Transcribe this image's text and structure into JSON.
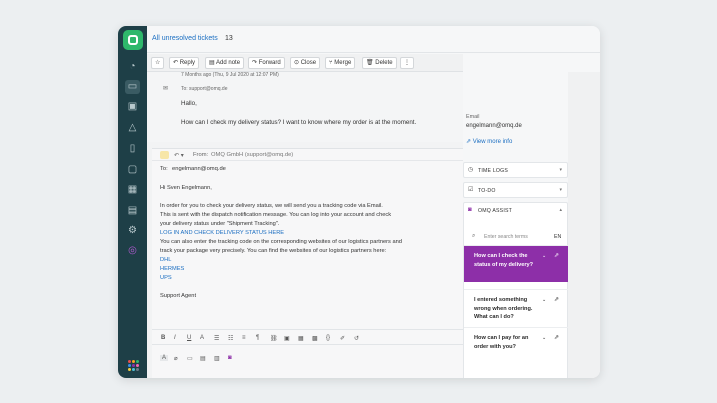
{
  "sidebar": {
    "icons": [
      "dashboard-icon",
      "tickets-icon",
      "contacts-icon",
      "bell-icon",
      "book-icon",
      "chat-icon",
      "grid-icon",
      "code-icon",
      "settings-icon",
      "omq-icon",
      "apps-icon"
    ],
    "dot_colors": [
      "#e94f4f",
      "#f4a623",
      "#2eb86b",
      "#3b8eea",
      "#8d2fa8",
      "#f26bb0",
      "#f4d03f",
      "#4cc3d9",
      "#6c7a89"
    ]
  },
  "header": {
    "breadcrumb": "All unresolved tickets",
    "count": "13"
  },
  "toolbar": {
    "star": "☆",
    "reply": "Reply",
    "add_note": "Add note",
    "forward": "Forward",
    "close": "Close",
    "merge": "Merge",
    "delete": "Delete",
    "more": "⋮"
  },
  "message": {
    "timestamp": "7 Months ago (Thu, 9 Jul 2020 at 12:07 PM)",
    "to": "To: support@omq.de",
    "greeting": "Hallo,",
    "body": "How can I check my delivery status? I want to know where my order is at the moment."
  },
  "reply": {
    "from_label": "From:",
    "from_value": "OMQ GmbH (support@omq.de)",
    "to_label": "To:",
    "to_value": "engelmann@omq.de",
    "lines": [
      "Hi Sven Engelmann,",
      "",
      "In order for you to check your delivery status, we will send you a tracking code via Email.",
      "This is sent with the dispatch notification message. You can log into your account and check",
      "your delivery status under \"Shipment Tracking\"."
    ],
    "link1": "LOG IN AND CHECK DELIVERY STATUS HERE",
    "lines2": [
      "You can also enter the tracking code on the corresponding websites of our logistics partners and",
      "track your package very precisely. You can find the websites of our logistics partners here:"
    ],
    "partners": [
      "DHL",
      "HERMES",
      "UPS"
    ],
    "signature": "Support Agent"
  },
  "contact": {
    "email_label": "Email",
    "email": "engelmann@omq.de",
    "more": "View more info"
  },
  "sections": {
    "time_logs": "TIME LOGS",
    "todo": "TO-DO",
    "omq_assist": "OMQ ASSIST"
  },
  "assist": {
    "search_placeholder": "Enter search terms",
    "lang": "EN",
    "questions": [
      "How can I check the status of my delivery?",
      "I entered something wrong when ordering. What can I do?",
      "How can I pay for an order with you?"
    ]
  },
  "colors": {
    "sidebar": "#1e3f47",
    "brand": "#2eb86b",
    "link": "#1c6fc2",
    "assist_accent": "#8d2fa8"
  }
}
